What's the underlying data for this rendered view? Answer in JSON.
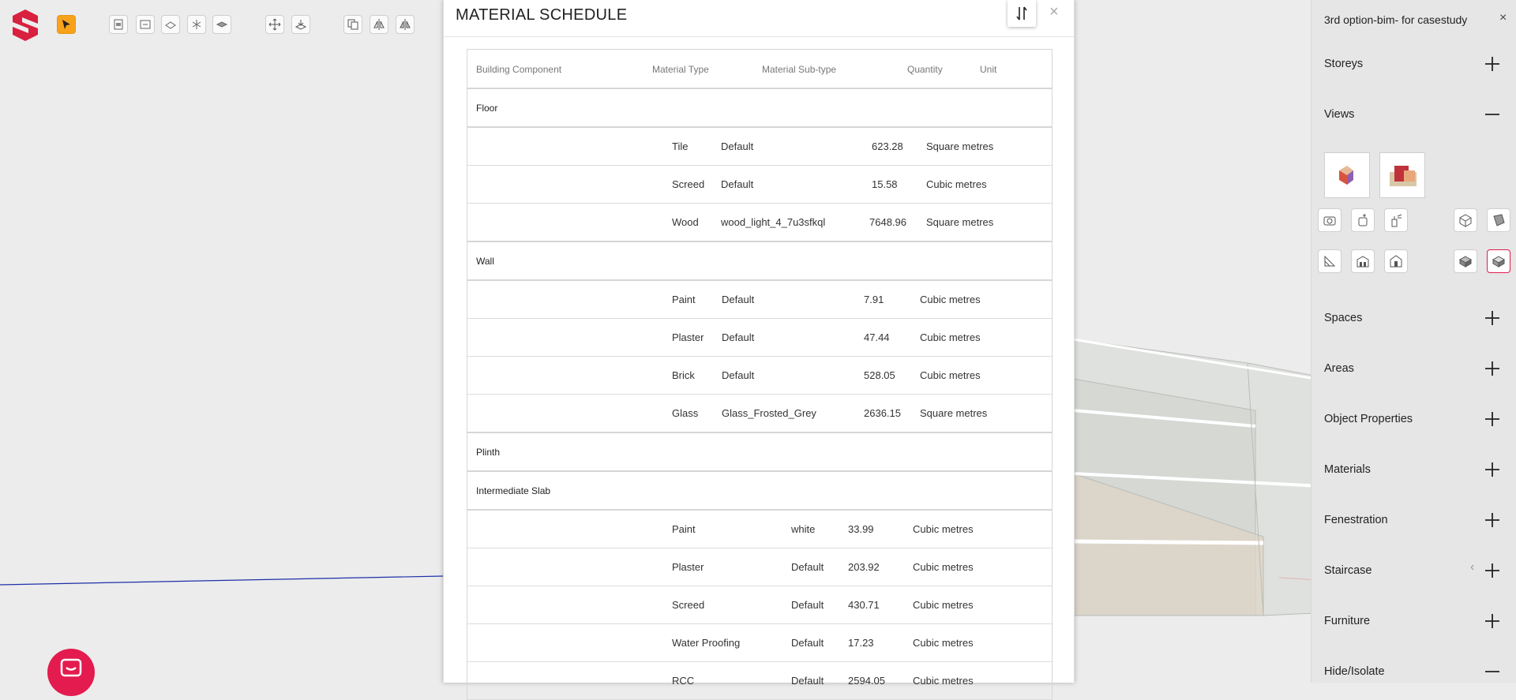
{
  "modal": {
    "title": "MATERIAL SCHEDULE",
    "close": "×",
    "columns": [
      "Building Component",
      "Material Type",
      "Material Sub-type",
      "Quantity",
      "Unit"
    ],
    "groups": [
      {
        "name": "Floor",
        "rows": [
          {
            "type": "Tile",
            "subtype": "Default",
            "qty": "623.28",
            "unit": "Square metres"
          },
          {
            "type": "Screed",
            "subtype": "Default",
            "qty": "15.58",
            "unit": "Cubic metres"
          },
          {
            "type": "Wood",
            "subtype": "wood_light_4_7u3sfkql",
            "qty": "7648.96",
            "unit": "Square metres"
          }
        ]
      },
      {
        "name": "Wall",
        "rows": [
          {
            "type": "Paint",
            "subtype": "Default",
            "qty": "7.91",
            "unit": "Cubic metres"
          },
          {
            "type": "Plaster",
            "subtype": "Default",
            "qty": "47.44",
            "unit": "Cubic metres"
          },
          {
            "type": "Brick",
            "subtype": "Default",
            "qty": "528.05",
            "unit": "Cubic metres"
          },
          {
            "type": "Glass",
            "subtype": "Glass_Frosted_Grey",
            "qty": "2636.15",
            "unit": "Square metres"
          }
        ]
      },
      {
        "name": "Plinth",
        "rows": []
      },
      {
        "name": "Intermediate Slab",
        "rows": [
          {
            "type": "Paint",
            "subtype": "white",
            "qty": "33.99",
            "unit": "Cubic metres"
          },
          {
            "type": "Plaster",
            "subtype": "Default",
            "qty": "203.92",
            "unit": "Cubic metres"
          },
          {
            "type": "Screed",
            "subtype": "Default",
            "qty": "430.71",
            "unit": "Cubic metres"
          },
          {
            "type": "Water Proofing",
            "subtype": "Default",
            "qty": "17.23",
            "unit": "Cubic metres"
          },
          {
            "type": "RCC",
            "subtype": "Default",
            "qty": "2594.05",
            "unit": "Cubic metres"
          }
        ]
      }
    ]
  },
  "sidebar": {
    "project_title": "3rd option-bim- for casestudy",
    "close": "×",
    "sections": [
      {
        "label": "Storeys",
        "state": "collapsed"
      },
      {
        "label": "Views",
        "state": "expanded"
      },
      {
        "label": "Spaces",
        "state": "collapsed"
      },
      {
        "label": "Areas",
        "state": "collapsed"
      },
      {
        "label": "Object Properties",
        "state": "collapsed"
      },
      {
        "label": "Materials",
        "state": "collapsed"
      },
      {
        "label": "Fenestration",
        "state": "collapsed"
      },
      {
        "label": "Staircase",
        "state": "collapsed"
      },
      {
        "label": "Furniture",
        "state": "collapsed"
      },
      {
        "label": "Hide/Isolate",
        "state": "expanded"
      }
    ],
    "collapse_arrow": "‹"
  },
  "colors": {
    "brand": "#e31b4e",
    "active_tool": "#f7a21b",
    "axis_line": "#1f2fa8"
  }
}
